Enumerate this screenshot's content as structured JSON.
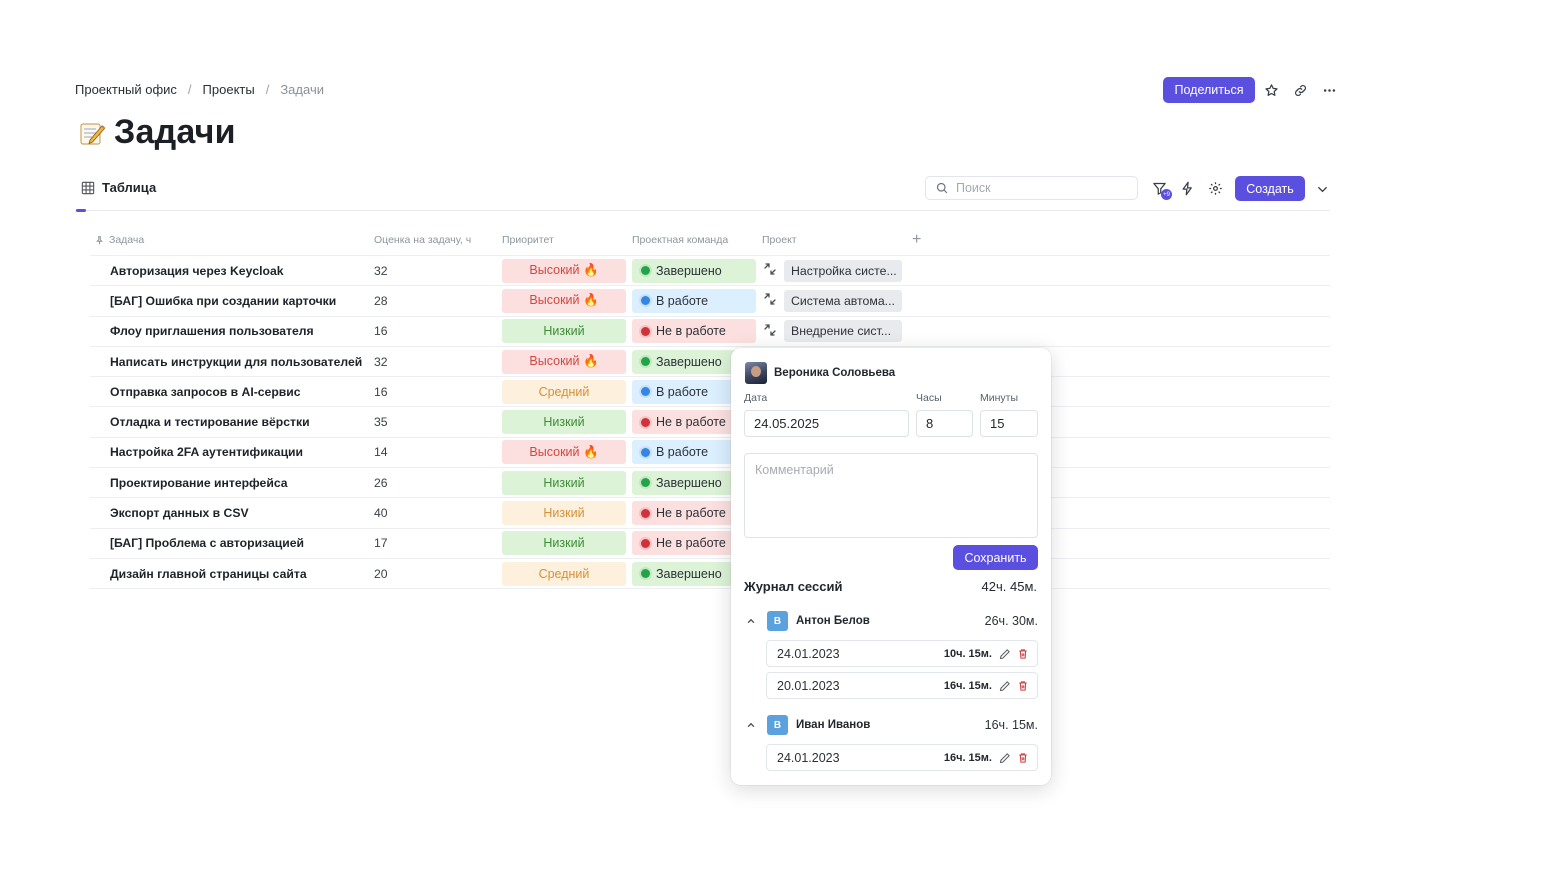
{
  "breadcrumb": [
    "Проектный офис",
    "Проекты",
    "Задачи"
  ],
  "header": {
    "share_label": "Поделиться",
    "title": "Задачи",
    "title_emoji": "memo"
  },
  "view": {
    "tab_label": "Таблица",
    "search_placeholder": "Поиск",
    "filter_badge": "+9",
    "create_label": "Создать"
  },
  "table": {
    "columns": [
      "Задача",
      "Оценка на задачу, ч",
      "Приоритет",
      "Проектная команда",
      "Проект"
    ],
    "add_column": "+",
    "rows": [
      {
        "task": "Авторизация через Keycloak",
        "est": "32",
        "priority": "Высокий 🔥",
        "prio_type": "high",
        "team": "Завершено",
        "team_type": "done",
        "project": "Настройка систе..."
      },
      {
        "task": "[БАГ] Ошибка при создании карточки",
        "est": "28",
        "priority": "Высокий 🔥",
        "prio_type": "high",
        "team": "В работе",
        "team_type": "work",
        "project": "Система автома..."
      },
      {
        "task": "Флоу приглашения пользователя",
        "est": "16",
        "priority": "Низкий",
        "prio_type": "low",
        "team": "Не в работе",
        "team_type": "not",
        "project": "Внедрение сист..."
      },
      {
        "task": "Написать инструкции для пользователей",
        "est": "32",
        "priority": "Высокий 🔥",
        "prio_type": "high",
        "team": "Завершено",
        "team_type": "done",
        "project": ""
      },
      {
        "task": "Отправка запросов в AI-сервис",
        "est": "16",
        "priority": "Средний",
        "prio_type": "mid",
        "team": "В работе",
        "team_type": "work",
        "project": ""
      },
      {
        "task": "Отладка и тестирование вёрстки",
        "est": "35",
        "priority": "Низкий",
        "prio_type": "low",
        "team": "Не в работе",
        "team_type": "not",
        "project": ""
      },
      {
        "task": "Настройка 2FA аутентификации",
        "est": "14",
        "priority": "Высокий 🔥",
        "prio_type": "high",
        "team": "В работе",
        "team_type": "work",
        "project": ""
      },
      {
        "task": "Проектирование интерфейса",
        "est": "26",
        "priority": "Низкий",
        "prio_type": "low",
        "team": "Завершено",
        "team_type": "done",
        "project": ""
      },
      {
        "task": "Экспорт данных в CSV",
        "est": "40",
        "priority": "Низкий",
        "prio_type": "mid",
        "team": "Не в работе",
        "team_type": "not",
        "project": ""
      },
      {
        "task": "[БАГ] Проблема с авторизацией",
        "est": "17",
        "priority": "Низкий",
        "prio_type": "low",
        "team": "Не в работе",
        "team_type": "not",
        "project": ""
      },
      {
        "task": "Дизайн главной страницы сайта",
        "est": "20",
        "priority": "Средний",
        "prio_type": "mid",
        "team": "Завершено",
        "team_type": "done",
        "project": ""
      }
    ]
  },
  "popover": {
    "user_name": "Вероника Соловьева",
    "date_label": "Дата",
    "hours_label": "Часы",
    "minutes_label": "Минуты",
    "date_value": "24.05.2025",
    "hours_value": "8",
    "minutes_value": "15",
    "comment_placeholder": "Комментарий",
    "save_label": "Сохранить",
    "journal_title": "Журнал сессий",
    "journal_total": "42ч. 45м.",
    "groups": [
      {
        "badge": "B",
        "name": "Антон Белов",
        "total": "26ч. 30м.",
        "entries": [
          {
            "date": "24.01.2023",
            "time": "10ч. 15м."
          },
          {
            "date": "20.01.2023",
            "time": "16ч. 15м."
          }
        ]
      },
      {
        "badge": "B",
        "name": "Иван Иванов",
        "total": "16ч. 15м.",
        "entries": [
          {
            "date": "24.01.2023",
            "time": "16ч. 15м."
          }
        ]
      }
    ]
  },
  "colors": {
    "accent": "#5b4fe0",
    "priority_high_bg": "#fbe0df",
    "priority_low_bg": "#dcf3d8",
    "priority_mid_bg": "#fdf0dd",
    "status_done": "#23a44b",
    "status_work": "#3585e3",
    "status_not": "#d2313a"
  }
}
